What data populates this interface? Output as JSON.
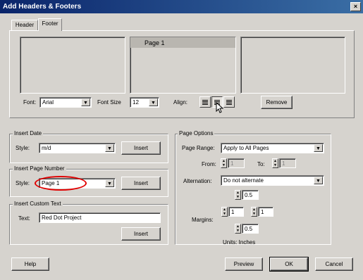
{
  "window": {
    "title": "Add Headers & Footers",
    "close_glyph": "×"
  },
  "tabs": [
    {
      "label": "Header",
      "active": false
    },
    {
      "label": "Footer",
      "active": true
    }
  ],
  "preview": {
    "left_text": "",
    "center_text": "Page 1",
    "right_text": ""
  },
  "font": {
    "label": "Font:",
    "value": "Arial"
  },
  "font_size": {
    "label": "Font Size",
    "value": "12"
  },
  "align": {
    "label": "Align:"
  },
  "remove_button": "Remove",
  "insert_date": {
    "group_label": "Insert Date",
    "style_label": "Style:",
    "style_value": "m/d",
    "insert_button": "Insert"
  },
  "insert_page_number": {
    "group_label": "Insert Page Number",
    "style_label": "Style:",
    "style_value": "Page 1",
    "insert_button": "Insert"
  },
  "insert_custom_text": {
    "group_label": "Insert Custom Text",
    "text_label": "Text:",
    "text_value": "Red Dot Project",
    "insert_button": "Insert"
  },
  "page_options": {
    "group_label": "Page Options",
    "page_range_label": "Page Range:",
    "page_range_value": "Apply to All Pages",
    "from_label": "From:",
    "from_value": "1",
    "to_label": "To:",
    "to_value": "1",
    "alternation_label": "Alternation:",
    "alternation_value": "Do not alternate",
    "margins_label": "Margins:",
    "margin_top": "0.5",
    "margin_left": "1",
    "margin_right": "1",
    "margin_bottom": "0.5",
    "units": "Units: Inches"
  },
  "buttons": {
    "help": "Help",
    "preview": "Preview",
    "ok": "OK",
    "cancel": "Cancel"
  },
  "colors": {
    "annotation": "#e00000",
    "titlebar": "#0a246a"
  }
}
